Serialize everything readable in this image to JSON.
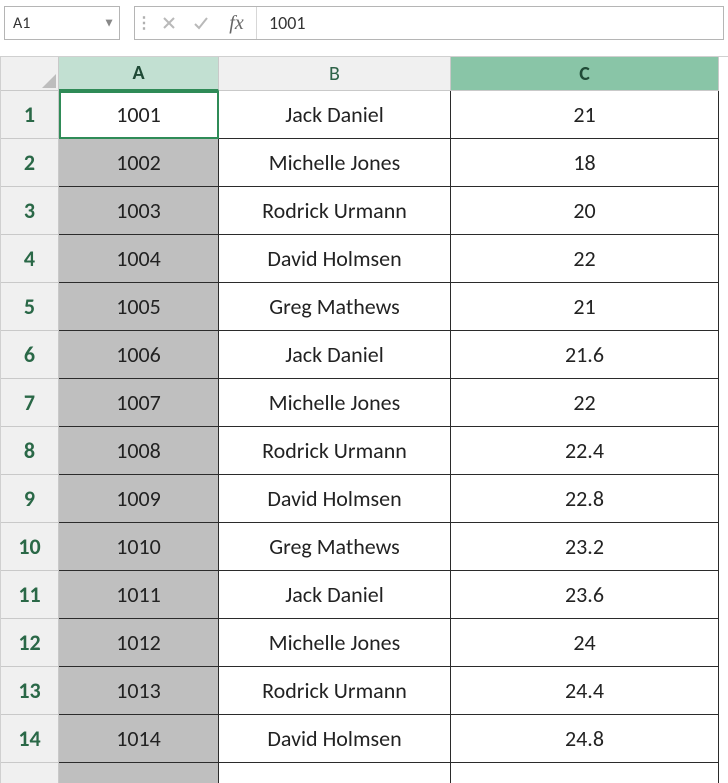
{
  "name_box": {
    "value": "A1"
  },
  "formula_bar": {
    "fx_label": "fx",
    "value": "1001"
  },
  "columns": {
    "A": "A",
    "B": "B",
    "C": "C"
  },
  "active_cell": "A1",
  "selected_column": "A",
  "rows": [
    {
      "n": "1",
      "A": "1001",
      "B": "Jack Daniel",
      "C": "21"
    },
    {
      "n": "2",
      "A": "1002",
      "B": "Michelle Jones",
      "C": "18"
    },
    {
      "n": "3",
      "A": "1003",
      "B": "Rodrick Urmann",
      "C": "20"
    },
    {
      "n": "4",
      "A": "1004",
      "B": "David Holmsen",
      "C": "22"
    },
    {
      "n": "5",
      "A": "1005",
      "B": "Greg Mathews",
      "C": "21"
    },
    {
      "n": "6",
      "A": "1006",
      "B": "Jack Daniel",
      "C": "21.6"
    },
    {
      "n": "7",
      "A": "1007",
      "B": "Michelle Jones",
      "C": "22"
    },
    {
      "n": "8",
      "A": "1008",
      "B": "Rodrick Urmann",
      "C": "22.4"
    },
    {
      "n": "9",
      "A": "1009",
      "B": "David Holmsen",
      "C": "22.8"
    },
    {
      "n": "10",
      "A": "1010",
      "B": "Greg Mathews",
      "C": "23.2"
    },
    {
      "n": "11",
      "A": "1011",
      "B": "Jack Daniel",
      "C": "23.6"
    },
    {
      "n": "12",
      "A": "1012",
      "B": "Michelle Jones",
      "C": "24"
    },
    {
      "n": "13",
      "A": "1013",
      "B": "Rodrick Urmann",
      "C": "24.4"
    },
    {
      "n": "14",
      "A": "1014",
      "B": "David Holmsen",
      "C": "24.8"
    }
  ]
}
